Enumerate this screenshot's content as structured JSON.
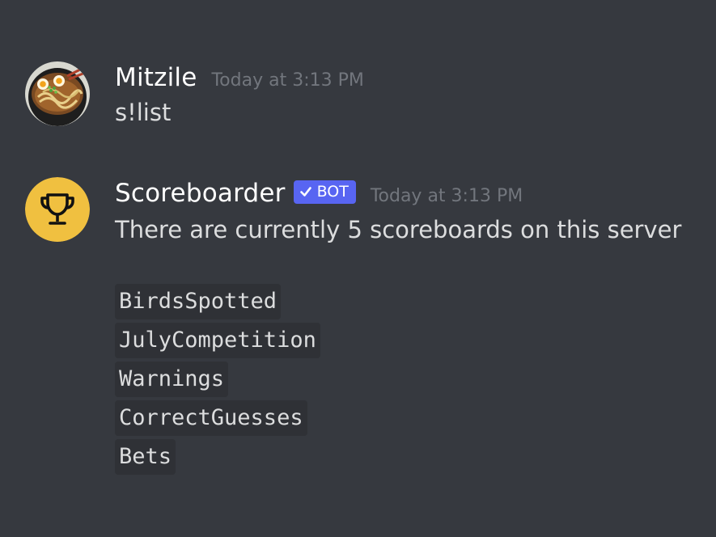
{
  "messages": [
    {
      "author": "Mitzile",
      "timestamp": "Today at 3:13 PM",
      "avatar_icon": "ramen-bowl-icon",
      "text": "s!list"
    },
    {
      "author": "Scoreboarder",
      "badge": {
        "icon": "checkmark-icon",
        "label": "BOT",
        "color": "#5865f2"
      },
      "timestamp": "Today at 3:13 PM",
      "avatar_icon": "trophy-icon",
      "avatar_color": "#f0c040",
      "text": "There are currently 5 scoreboards on this server",
      "scoreboards": [
        "BirdsSpotted",
        "JulyCompetition",
        "Warnings",
        "CorrectGuesses",
        "Bets"
      ]
    }
  ],
  "colors": {
    "background": "#36393f",
    "code_background": "#2f3136",
    "username": "#ffffff",
    "timestamp": "#72767d",
    "text": "#dcddde"
  }
}
